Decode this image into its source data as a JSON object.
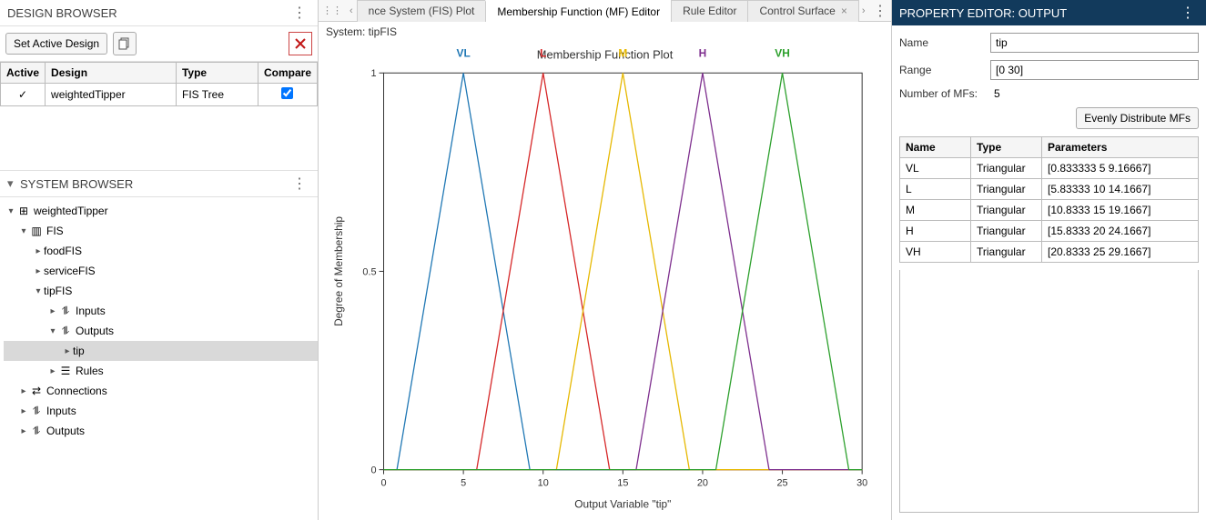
{
  "design_browser": {
    "title": "DESIGN BROWSER",
    "set_active": "Set Active Design",
    "columns": {
      "active": "Active",
      "design": "Design",
      "type": "Type",
      "compare": "Compare"
    },
    "rows": [
      {
        "active": "✓",
        "design": "weightedTipper",
        "type": "FIS Tree",
        "compare_checked": true
      }
    ]
  },
  "system_browser": {
    "title": "SYSTEM BROWSER",
    "tree": {
      "root": "weightedTipper",
      "fis_label": "FIS",
      "food": "foodFIS",
      "service": "serviceFIS",
      "tipfis": "tipFIS",
      "inputs": "Inputs",
      "outputs": "Outputs",
      "tip": "tip",
      "rules": "Rules",
      "connections": "Connections",
      "inputs2": "Inputs",
      "outputs2": "Outputs"
    }
  },
  "tabs": {
    "t1": "nce System (FIS) Plot",
    "t2": "Membership Function (MF) Editor",
    "t3": "Rule Editor",
    "t4": "Control Surface"
  },
  "system_line": "System: tipFIS",
  "property_editor": {
    "title": "PROPERTY EDITOR: OUTPUT",
    "name_label": "Name",
    "name_value": "tip",
    "range_label": "Range",
    "range_value": "[0 30]",
    "nmfs_label": "Number of MFs:",
    "nmfs_value": "5",
    "distribute_btn": "Evenly Distribute MFs",
    "cols": {
      "name": "Name",
      "type": "Type",
      "params": "Parameters"
    },
    "rows": [
      {
        "name": "VL",
        "type": "Triangular",
        "params": "[0.833333 5 9.16667]"
      },
      {
        "name": "L",
        "type": "Triangular",
        "params": "[5.83333 10 14.1667]"
      },
      {
        "name": "M",
        "type": "Triangular",
        "params": "[10.8333 15 19.1667]"
      },
      {
        "name": "H",
        "type": "Triangular",
        "params": "[15.8333 20 24.1667]"
      },
      {
        "name": "VH",
        "type": "Triangular",
        "params": "[20.8333 25 29.1667]"
      }
    ]
  },
  "chart_data": {
    "type": "line",
    "title": "Membership Function Plot",
    "xlabel": "Output Variable \"tip\"",
    "ylabel": "Degree of Membership",
    "xlim": [
      0,
      30
    ],
    "ylim": [
      0,
      1
    ],
    "xticks": [
      0,
      5,
      10,
      15,
      20,
      25,
      30
    ],
    "yticks": [
      0,
      0.5,
      1
    ],
    "series": [
      {
        "name": "VL",
        "color": "#1f77b4",
        "points": [
          [
            0.833333,
            0
          ],
          [
            5,
            1
          ],
          [
            9.16667,
            0
          ]
        ]
      },
      {
        "name": "L",
        "color": "#d62728",
        "points": [
          [
            5.83333,
            0
          ],
          [
            10,
            1
          ],
          [
            14.1667,
            0
          ]
        ]
      },
      {
        "name": "M",
        "color": "#e6b800",
        "points": [
          [
            10.8333,
            0
          ],
          [
            15,
            1
          ],
          [
            19.1667,
            0
          ]
        ]
      },
      {
        "name": "H",
        "color": "#7e2f8e",
        "points": [
          [
            15.8333,
            0
          ],
          [
            20,
            1
          ],
          [
            24.1667,
            0
          ]
        ]
      },
      {
        "name": "VH",
        "color": "#2ca02c",
        "points": [
          [
            20.8333,
            0
          ],
          [
            25,
            1
          ],
          [
            29.1667,
            0
          ]
        ]
      }
    ]
  }
}
